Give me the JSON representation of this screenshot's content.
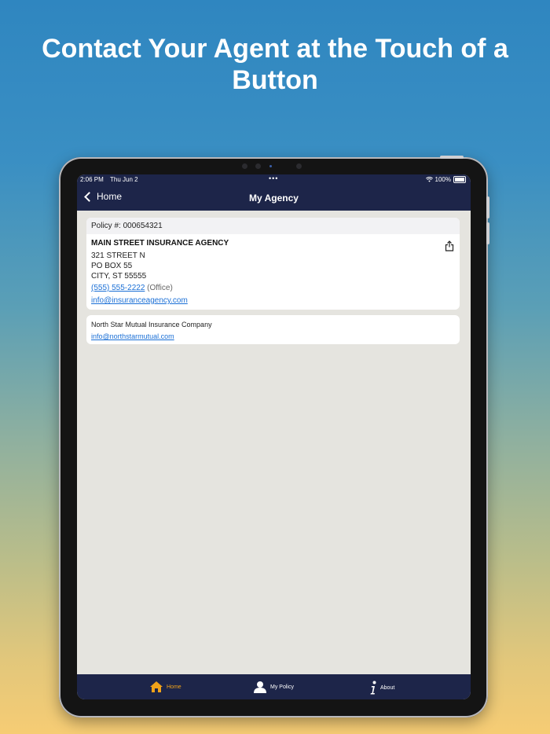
{
  "headline": "Contact Your Agent at the Touch of a Button",
  "status": {
    "time": "2:06 PM",
    "date": "Thu Jun 2",
    "battery": "100%"
  },
  "nav": {
    "back_label": "Home",
    "title": "My Agency"
  },
  "policy": {
    "label": "Policy #: 000654321"
  },
  "agency": {
    "name": "MAIN STREET INSURANCE AGENCY",
    "address_line1": "321 STREET N",
    "address_line2": "PO BOX 55",
    "address_line3": "CITY, ST 55555",
    "phone": "(555) 555-2222",
    "phone_type": "(Office)",
    "email": "info@insuranceagency.com"
  },
  "company": {
    "name": "North Star Mutual Insurance Company",
    "email": "info@northstarmutual.com"
  },
  "tabs": [
    {
      "label": "Home",
      "icon": "home-icon",
      "active": true
    },
    {
      "label": "My Policy",
      "icon": "person-icon",
      "active": false
    },
    {
      "label": "About",
      "icon": "info-icon",
      "active": false
    }
  ],
  "colors": {
    "nav": "#1d2549",
    "accent": "#f0a21a",
    "link": "#1a6fd6"
  }
}
